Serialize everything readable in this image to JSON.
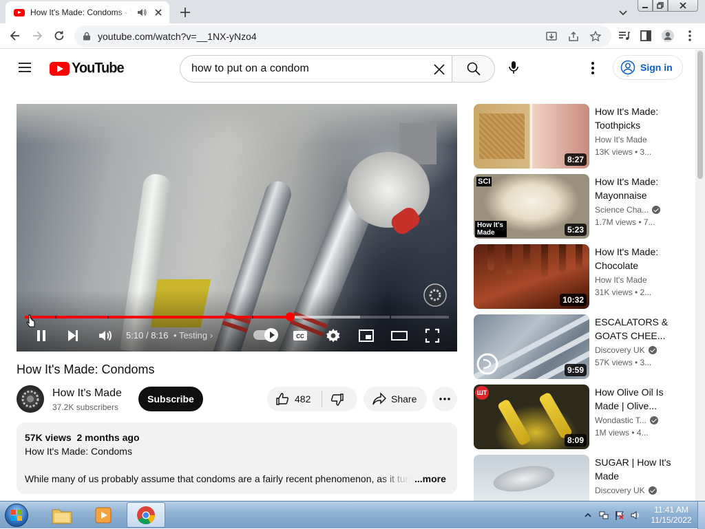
{
  "browser": {
    "tab_title": "How It's Made: Condoms - YouTube",
    "url": "youtube.com/watch?v=__1NX-yNzo4"
  },
  "youtube": {
    "logo_text": "YouTube",
    "search_query": "how to put on a condom",
    "sign_in_label": "Sign in"
  },
  "player": {
    "time_current": "5:10",
    "time_separator": "/",
    "time_total": "8:16",
    "chapter_label": "Testing",
    "progress_fraction": 0.625,
    "buffered_fraction": 0.79
  },
  "video": {
    "title": "How It's Made: Condoms",
    "channel_name": "How It's Made",
    "subscribers": "37.2K subscribers",
    "subscribe_label": "Subscribe",
    "like_count": "482",
    "share_label": "Share",
    "views_line": "57K views  2 months ago",
    "description_title": "How It's Made: Condoms",
    "description_text": "While many of us probably assume that condoms are a fairly recent phenomenon, as it turns out condoms have",
    "more_label": "...more"
  },
  "recommendations": [
    {
      "title": "How It's Made: Toothpicks",
      "channel": "How It's Made",
      "verified": false,
      "meta": "13K views  • 3...",
      "duration": "8:27"
    },
    {
      "title": "How It's Made: Mayonnaise",
      "channel": "Science Cha...",
      "verified": true,
      "meta": "1.7M views  • 7...",
      "duration": "5:23",
      "badge_top": "SCI",
      "badge_bottom": "How It's Made"
    },
    {
      "title": "How It's Made: Chocolate",
      "channel": "How It's Made",
      "verified": false,
      "meta": "31K views  • 2...",
      "duration": "10:32"
    },
    {
      "title": "ESCALATORS & GOATS CHEE...",
      "channel": "Discovery UK",
      "verified": true,
      "meta": "57K views  • 3...",
      "duration": "9:59"
    },
    {
      "title": "How Olive Oil Is Made | Olive...",
      "channel": "Wondastic T...",
      "verified": true,
      "meta": "1M views  • 4...",
      "duration": "8:09",
      "badge_channel": "ШТ"
    },
    {
      "title": "SUGAR | How It's Made",
      "channel": "Discovery UK",
      "verified": true,
      "meta": "",
      "duration": ""
    }
  ],
  "taskbar": {
    "time": "11:41 AM",
    "date": "11/15/2022"
  },
  "colors": {
    "youtube_red": "#ff0000",
    "link_blue": "#065fd4",
    "subscribe_bg": "#0f0f0f"
  }
}
